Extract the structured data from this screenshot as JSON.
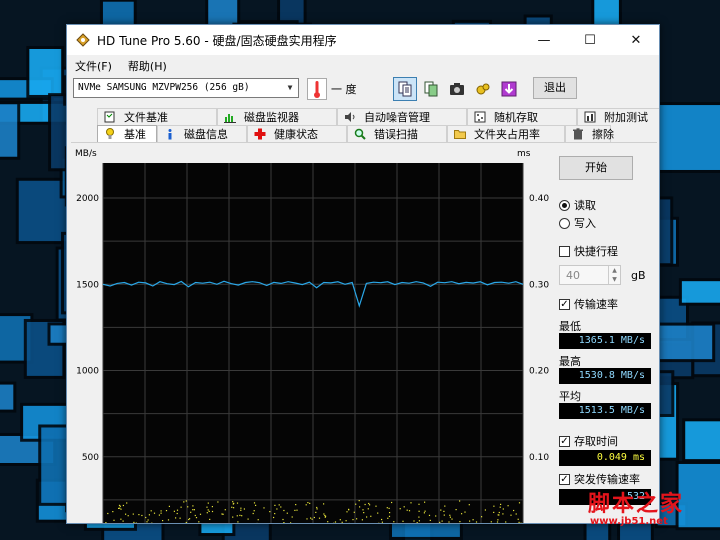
{
  "window": {
    "title": "HD Tune Pro 5.60 - 硬盘/固态硬盘实用程序",
    "minimize_glyph": "—",
    "maximize_glyph": "☐",
    "close_glyph": "✕"
  },
  "menu": [
    "文件(F)",
    "帮助(H)"
  ],
  "toolbar": {
    "drive": "NVMe    SAMSUNG MZVPW256 (256 gB)",
    "temperature": "一 度",
    "exit_label": "退出",
    "icons": [
      "copy-text-icon",
      "copy-screen-icon",
      "camera-icon",
      "options-icon",
      "save-icon"
    ]
  },
  "tabs_back": [
    {
      "label": "文件基准",
      "icon": "file-benchmark-icon"
    },
    {
      "label": "磁盘监视器",
      "icon": "disk-monitor-icon"
    },
    {
      "label": "自动噪音管理",
      "icon": "aam-icon"
    },
    {
      "label": "随机存取",
      "icon": "random-access-icon"
    },
    {
      "label": "附加测试",
      "icon": "extra-tests-icon"
    }
  ],
  "tabs_front": [
    {
      "label": "基准",
      "icon": "benchmark-icon",
      "selected": true
    },
    {
      "label": "磁盘信息",
      "icon": "info-icon"
    },
    {
      "label": "健康状态",
      "icon": "health-icon"
    },
    {
      "label": "错误扫描",
      "icon": "error-scan-icon"
    },
    {
      "label": "文件夹占用率",
      "icon": "folder-usage-icon"
    },
    {
      "label": "擦除",
      "icon": "erase-icon"
    }
  ],
  "side": {
    "start_label": "开始",
    "read_label": "读取",
    "write_label": "写入",
    "short_stroke_label": "快捷行程",
    "short_stroke_value": "40",
    "short_stroke_unit": "gB",
    "transfer_rate_label": "传输速率",
    "min_label": "最低",
    "min_value": "1365.1 MB/s",
    "max_label": "最高",
    "max_value": "1530.8 MB/s",
    "avg_label": "平均",
    "avg_value": "1513.5 MB/s",
    "access_time_label": "存取时间",
    "access_time_value": "0.049 ms",
    "burst_rate_label": "突发传输速率",
    "burst_rate_value": "532"
  },
  "chart_data": {
    "type": "line",
    "left_unit": "MB/s",
    "right_unit": "ms",
    "left_ticks": [
      "2000",
      "1500",
      "1000",
      "500"
    ],
    "right_ticks": [
      "0.40",
      "0.30",
      "0.20",
      "0.10"
    ],
    "ylim_left": [
      0,
      2000
    ],
    "ylim_right": [
      0,
      0.4
    ],
    "grid": true,
    "transfer_series": [
      1500,
      1490,
      1505,
      1510,
      1495,
      1512,
      1508,
      1490,
      1515,
      1503,
      1498,
      1516,
      1485,
      1510,
      1506,
      1512,
      1500,
      1517,
      1504,
      1495,
      1510,
      1515,
      1509,
      1493,
      1511,
      1505,
      1515,
      1507,
      1498,
      1512,
      1480,
      1510,
      1508,
      1514,
      1500,
      1510,
      1375,
      1505,
      1512,
      1509,
      1514,
      1498,
      1510,
      1506,
      1515,
      1508,
      1488,
      1512,
      1509,
      1515,
      1503,
      1511,
      1507,
      1514,
      1497,
      1510,
      1512,
      1506,
      1515,
      1500
    ],
    "access_time_band_ms": [
      0.005,
      0.05
    ]
  },
  "watermark": {
    "cn": "脚本之家",
    "url": "www.jb51.net"
  }
}
